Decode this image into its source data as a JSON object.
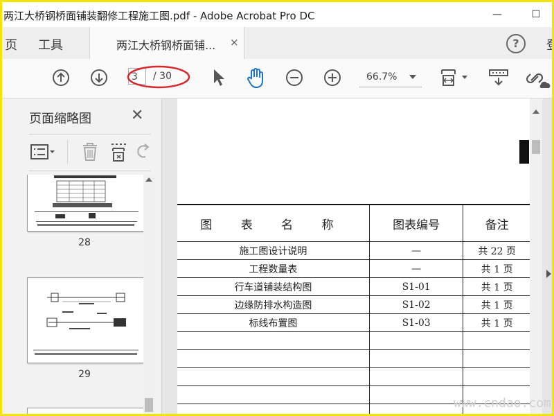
{
  "window": {
    "title": "两江大桥钢桥面铺装翻修工程施工图.pdf - Adobe Acrobat Pro DC",
    "minimize": "—",
    "maximize": "☐"
  },
  "tabs": {
    "home_cut": "页",
    "tools": "工具",
    "doc_tab": "两江大桥钢桥面铺...",
    "doc_tab_close": "×",
    "help": "?",
    "right_cut": "登"
  },
  "toolbar": {
    "current_page": "3",
    "total_pages": "/ 30",
    "zoom": "66.7%"
  },
  "left_panel": {
    "title": "页面缩略图",
    "close": "✕",
    "thumbnails": [
      {
        "page_label": "28"
      },
      {
        "page_label": "29"
      }
    ]
  },
  "document": {
    "headers": [
      "图 表 名 称",
      "图表编号",
      "备注"
    ],
    "rows": [
      [
        "施工图设计说明",
        "—",
        "共 22 页"
      ],
      [
        "工程数量表",
        "—",
        "共 1 页"
      ],
      [
        "行车道铺装结构图",
        "S1-01",
        "共 1 页"
      ],
      [
        "边缘防排水构造图",
        "S1-02",
        "共 1 页"
      ],
      [
        "标线布置图",
        "S1-03",
        "共 1 页"
      ],
      [
        "",
        "",
        ""
      ],
      [
        "",
        "",
        ""
      ],
      [
        "",
        "",
        ""
      ],
      [
        "",
        "",
        ""
      ],
      [
        "",
        "",
        ""
      ]
    ]
  },
  "watermark": "www.cndao.com",
  "colors": {
    "frame_border": "#f2e500",
    "accent_blue": "#1e73c8",
    "annotation_red": "#d9262b"
  }
}
